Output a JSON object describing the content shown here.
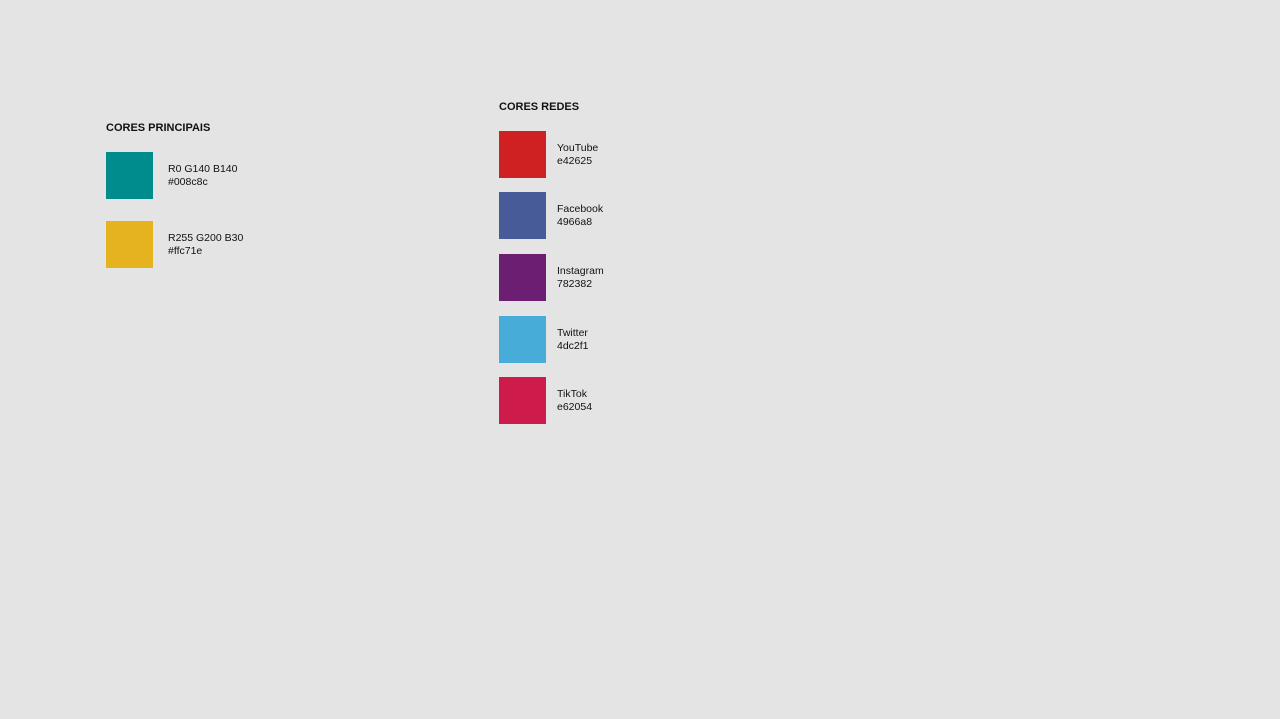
{
  "principais": {
    "title": "CORES PRINCIPAIS",
    "swatches": [
      {
        "color": "#008c8c",
        "line1": "R0 G140 B140",
        "line2": "#008c8c"
      },
      {
        "color": "#e6b320",
        "line1": "R255 G200 B30",
        "line2": "#ffc71e"
      }
    ]
  },
  "redes": {
    "title": "CORES REDES",
    "swatches": [
      {
        "color": "#cf2122",
        "line1": "YouTube",
        "line2": "e42625"
      },
      {
        "color": "#465b98",
        "line1": "Facebook",
        "line2": "4966a8"
      },
      {
        "color": "#6c1f72",
        "line1": "Instagram",
        "line2": "782382"
      },
      {
        "color": "#47add8",
        "line1": "Twitter",
        "line2": "4dc2f1"
      },
      {
        "color": "#cd1c4b",
        "line1": "TikTok",
        "line2": "e62054"
      }
    ]
  }
}
